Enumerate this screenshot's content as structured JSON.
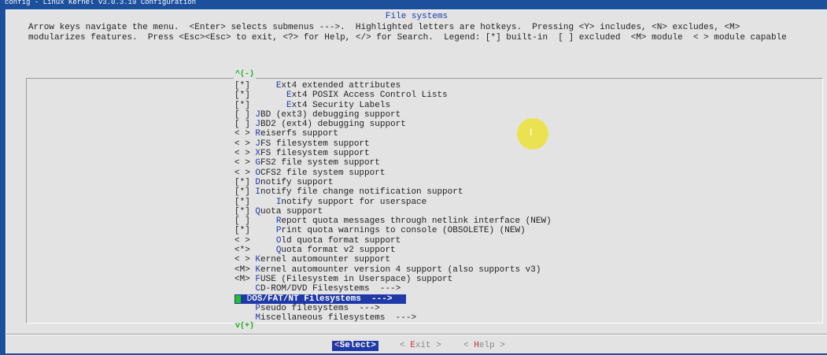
{
  "top_bar": "config - Linux Kernel v3.0.3.19 Configuration",
  "dialog": {
    "title": "File systems",
    "help_line1": "Arrow keys navigate the menu.  <Enter> selects submenus --->.  Highlighted letters are hotkeys.  Pressing <Y> includes, <N> excludes, <M>",
    "help_line2": "modularizes features.  Press <Esc><Esc> to exit, <?> for Help, </> for Search.  Legend: [*] built-in  [ ] excluded  <M> module  < > module capable"
  },
  "scroll": {
    "up": "^(-)",
    "down": "v(+)"
  },
  "menu": [
    {
      "prefix": "[*]     ",
      "hot": "E",
      "rest": "xt4 extended attributes"
    },
    {
      "prefix": "[*]       ",
      "hot": "E",
      "rest": "xt4 POSIX Access Control Lists"
    },
    {
      "prefix": "[*]       ",
      "hot": "E",
      "rest": "xt4 Security Labels"
    },
    {
      "prefix": "[ ] ",
      "hot": "J",
      "rest": "BD (ext3) debugging support"
    },
    {
      "prefix": "[ ] ",
      "hot": "J",
      "rest": "BD2 (ext4) debugging support"
    },
    {
      "prefix": "< > ",
      "hot": "R",
      "rest": "eiserfs support"
    },
    {
      "prefix": "< > ",
      "hot": "J",
      "rest": "FS filesystem support"
    },
    {
      "prefix": "< > ",
      "hot": "X",
      "rest": "FS filesystem support"
    },
    {
      "prefix": "< > ",
      "hot": "G",
      "rest": "FS2 file system support"
    },
    {
      "prefix": "< > ",
      "hot": "O",
      "rest": "CFS2 file system support"
    },
    {
      "prefix": "[*] ",
      "hot": "D",
      "rest": "notify support"
    },
    {
      "prefix": "[*] ",
      "hot": "I",
      "rest": "notify file change notification support"
    },
    {
      "prefix": "[*]     ",
      "hot": "I",
      "rest": "notify support for userspace"
    },
    {
      "prefix": "[*] ",
      "hot": "Q",
      "rest": "uota support"
    },
    {
      "prefix": "[ ]     ",
      "hot": "R",
      "rest": "eport quota messages through netlink interface (NEW)"
    },
    {
      "prefix": "[*]     ",
      "hot": "P",
      "rest": "rint quota warnings to console (OBSOLETE) (NEW)"
    },
    {
      "prefix": "< >     ",
      "hot": "O",
      "rest": "ld quota format support"
    },
    {
      "prefix": "<*>     ",
      "hot": "Q",
      "rest": "uota format v2 support"
    },
    {
      "prefix": "< > ",
      "hot": "K",
      "rest": "ernel automounter support"
    },
    {
      "prefix": "<M> ",
      "hot": "K",
      "rest": "ernel automounter version 4 support (also supports v3)"
    },
    {
      "prefix": "<M> ",
      "hot": "F",
      "rest": "USE (Filesystem in Userspace) support"
    },
    {
      "prefix": "    ",
      "hot": "C",
      "rest": "D-ROM/DVD Filesystems  --->"
    },
    {
      "prefix": "    ",
      "hot": "D",
      "rest": "OS/FAT/NT Filesystems  --->"
    },
    {
      "prefix": "    ",
      "hot": "P",
      "rest": "seudo filesystems  --->"
    },
    {
      "prefix": "    ",
      "hot": "M",
      "rest": "iscellaneous filesystems  --->"
    }
  ],
  "selected_index": 22,
  "buttons": {
    "select": {
      "hot": "<",
      "label": "Select",
      "tail": ">"
    },
    "exit": {
      "pre": "< ",
      "hot": "E",
      "label": "xit",
      "tail": " >"
    },
    "help": {
      "pre": "< ",
      "hot": "H",
      "label": "elp",
      "tail": " >"
    }
  },
  "cursor_glyph": "I",
  "colors": {
    "background": "#1c4f9c",
    "dialog": "#e3e3e3",
    "highlight": "#1f3aa8",
    "hotkey": "#1f3aa8",
    "scroll_indicator": "#19b019"
  }
}
